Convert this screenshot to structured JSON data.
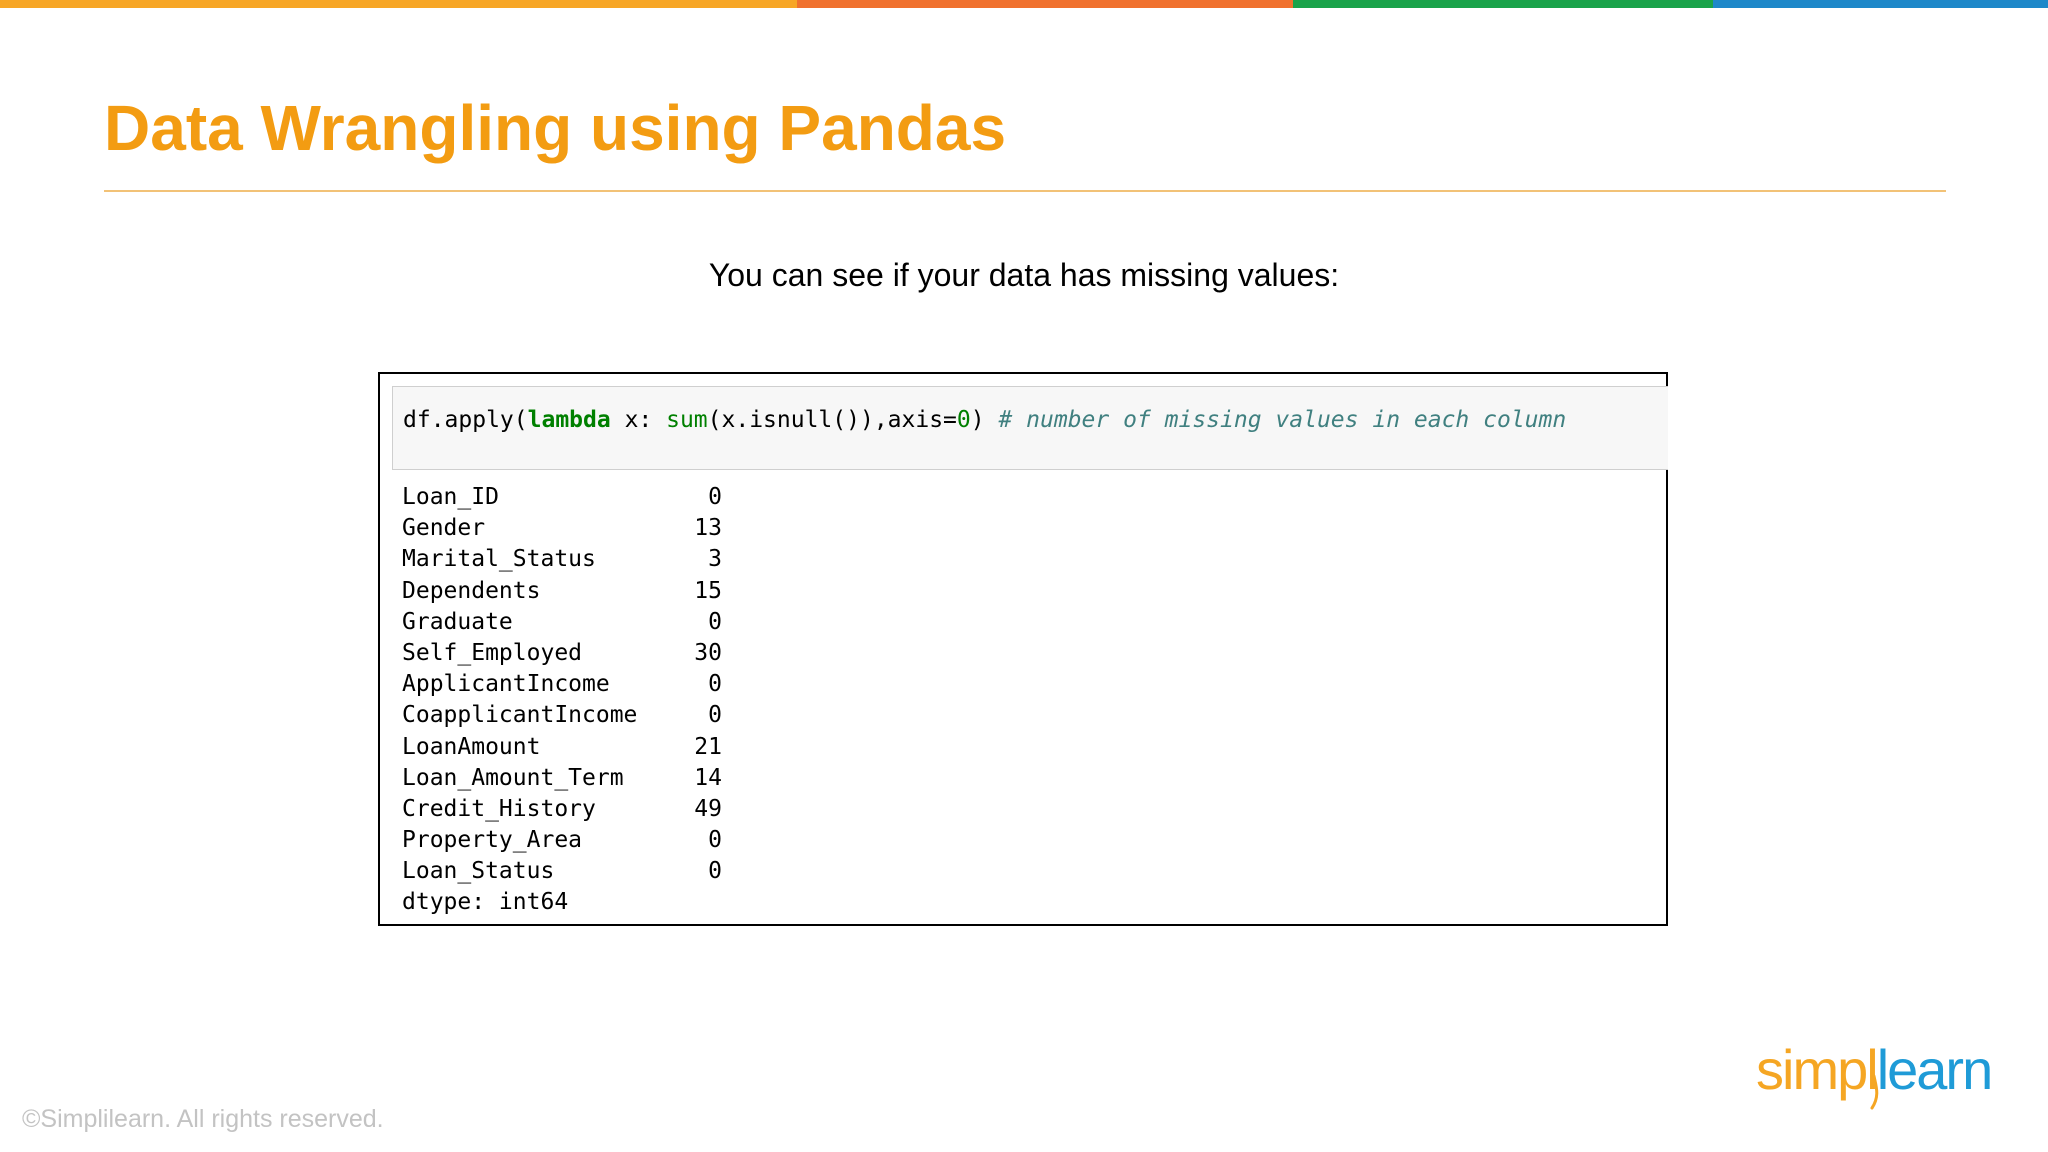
{
  "colors": {
    "bar": [
      "#f7a626",
      "#f0712e",
      "#1aa34a",
      "#1e88c9"
    ],
    "title": "#f39c12",
    "title_rule": "#f2c277"
  },
  "slide": {
    "title": "Data Wrangling using Pandas",
    "subtitle": "You can see if your data has missing values:"
  },
  "code_cell": {
    "tokens": {
      "t1": "df.apply(",
      "t2": "lambda",
      "t3": " x: ",
      "t4": "sum",
      "t5": "(x.isnull()),axis=",
      "t6": "0",
      "t7": ") ",
      "t8": "# number of missing values in each column"
    }
  },
  "output": {
    "rows": [
      {
        "name": "Loan_ID",
        "count": "0"
      },
      {
        "name": "Gender",
        "count": "13"
      },
      {
        "name": "Marital_Status",
        "count": "3"
      },
      {
        "name": "Dependents",
        "count": "15"
      },
      {
        "name": "Graduate",
        "count": "0"
      },
      {
        "name": "Self_Employed",
        "count": "30"
      },
      {
        "name": "ApplicantIncome",
        "count": "0"
      },
      {
        "name": "CoapplicantIncome",
        "count": "0"
      },
      {
        "name": "LoanAmount",
        "count": "21"
      },
      {
        "name": "Loan_Amount_Term",
        "count": "14"
      },
      {
        "name": "Credit_History",
        "count": "49"
      },
      {
        "name": "Property_Area",
        "count": "0"
      },
      {
        "name": "Loan_Status",
        "count": "0"
      }
    ],
    "dtype": "dtype: int64"
  },
  "footer": {
    "copyright": "©Simplilearn. All rights reserved.",
    "logo_part_1": "simpl",
    "logo_part_2": "learn"
  }
}
